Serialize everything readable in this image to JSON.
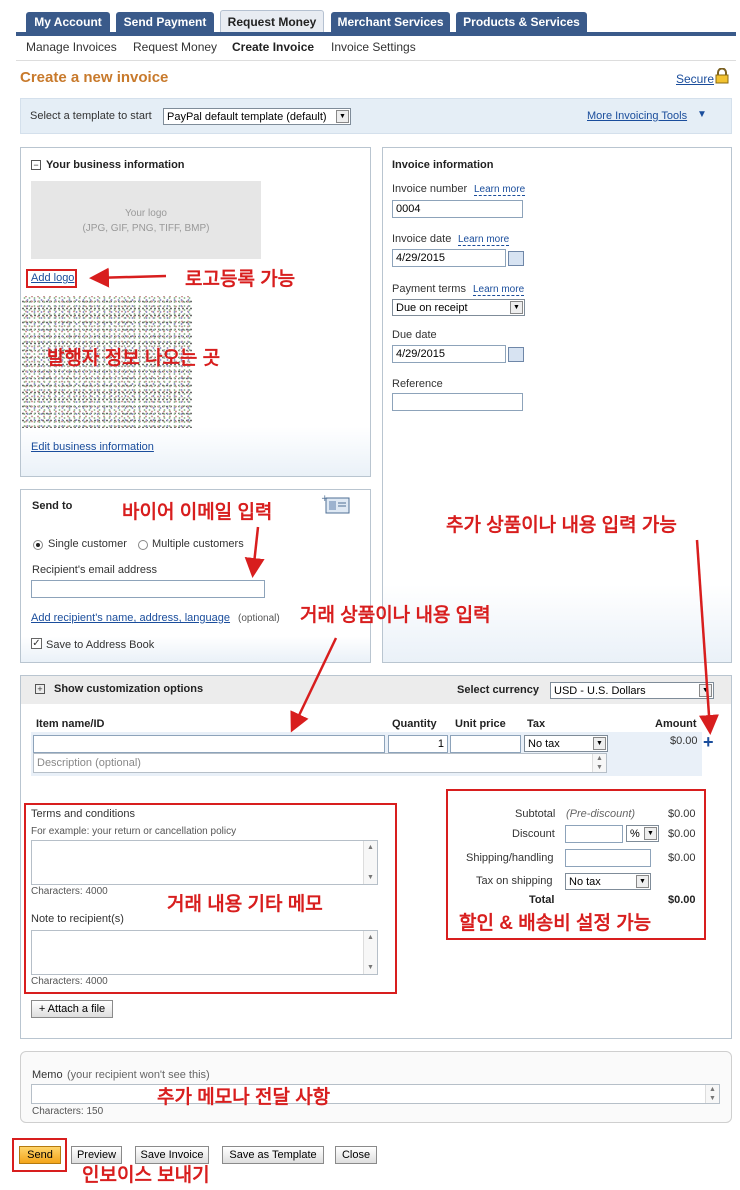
{
  "nav": {
    "tabs": [
      "My Account",
      "Send Payment",
      "Request Money",
      "Merchant Services",
      "Products & Services"
    ],
    "subtabs": [
      "Manage Invoices",
      "Request Money",
      "Create Invoice",
      "Invoice Settings"
    ]
  },
  "page": {
    "title": "Create a new invoice",
    "secure_label": "Secure"
  },
  "template": {
    "label": "Select a template to start",
    "selected": "PayPal default template (default)",
    "more_tools": "More Invoicing Tools"
  },
  "business": {
    "heading": "Your business information",
    "logo_line1": "Your logo",
    "logo_line2": "(JPG, GIF, PNG, TIFF, BMP)",
    "add_logo": "Add logo",
    "edit_link": "Edit business information"
  },
  "invoice_info": {
    "heading": "Invoice information",
    "number_label": "Invoice number",
    "number_value": "0004",
    "date_label": "Invoice date",
    "date_value": "4/29/2015",
    "terms_label": "Payment terms",
    "terms_value": "Due on receipt",
    "due_label": "Due date",
    "due_value": "4/29/2015",
    "reference_label": "Reference",
    "learn_more": "Learn more"
  },
  "send_to": {
    "heading": "Send to",
    "single": "Single customer",
    "multiple": "Multiple customers",
    "email_label": "Recipient's email address",
    "add_recipient": "Add recipient's name, address, language",
    "optional": "(optional)",
    "save_book": "Save to Address Book"
  },
  "items": {
    "customize": "Show customization options",
    "currency_label": "Select currency",
    "currency_value": "USD - U.S. Dollars",
    "col_item": "Item name/ID",
    "col_qty": "Quantity",
    "col_price": "Unit price",
    "col_tax": "Tax",
    "col_amount": "Amount",
    "qty_value": "1",
    "tax_value": "No tax",
    "amount_value": "$0.00",
    "desc_placeholder": "Description (optional)"
  },
  "terms": {
    "label": "Terms and conditions",
    "hint": "For example: your return or cancellation policy",
    "chars": "Characters: 4000",
    "note_label": "Note to recipient(s)",
    "note_chars": "Characters: 4000",
    "attach": "+ Attach a file"
  },
  "totals": {
    "subtotal_label": "Subtotal",
    "pre_discount": "(Pre-discount)",
    "subtotal": "$0.00",
    "discount_label": "Discount",
    "discount_unit": "%",
    "discount": "$0.00",
    "shipping_label": "Shipping/handling",
    "shipping": "$0.00",
    "tax_ship_label": "Tax on shipping",
    "tax_ship_value": "No tax",
    "total_label": "Total",
    "total": "$0.00"
  },
  "memo": {
    "label": "Memo",
    "hint": "(your recipient won't see this)",
    "chars": "Characters: 150"
  },
  "actions": {
    "send": "Send",
    "preview": "Preview",
    "save": "Save Invoice",
    "save_template": "Save as Template",
    "close": "Close"
  },
  "annotations": {
    "logo": "로고등록 가능",
    "issuer": "발행자 정보 나오는 곳",
    "buyer_email": "바이어 이메일 입력",
    "add_item": "추가 상품이나 내용 입력 가능",
    "item_entry": "거래 상품이나 내용 입력",
    "memo_terms": "거래 내용 기타 메모",
    "discount_ship": "할인 & 배송비 설정 가능",
    "extra_memo": "추가 메모나 전달 사항",
    "send_invoice": "인보이스 보내기"
  },
  "colors": {
    "tab_bg": "#3a5a8a",
    "title_orange": "#c87a2c",
    "link_blue": "#1a4d9c",
    "annotation_red": "#d81e1e",
    "send_button": "#f3a51b"
  }
}
